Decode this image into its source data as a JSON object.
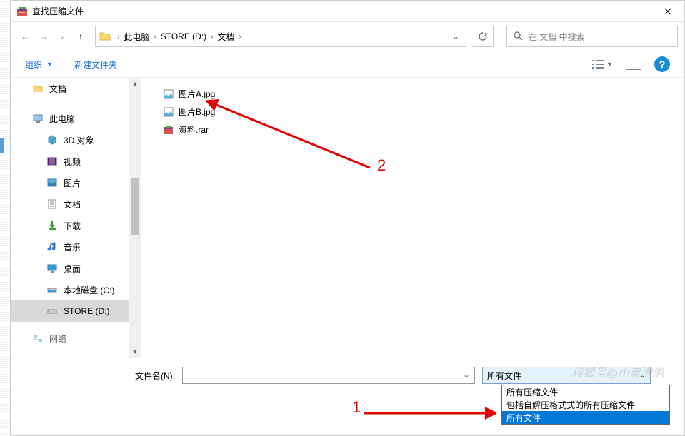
{
  "title": "查找压缩文件",
  "breadcrumbs": [
    "此电脑",
    "STORE (D:)",
    "文档"
  ],
  "search_placeholder": "在 文档 中搜索",
  "toolbar": {
    "organize": "组织",
    "new_folder": "新建文件夹"
  },
  "sidebar": {
    "quick": {
      "documents": "文档"
    },
    "this_pc": "此电脑",
    "children": {
      "objects3d": "3D 对象",
      "videos": "视频",
      "pictures": "图片",
      "documents": "文档",
      "downloads": "下载",
      "music": "音乐",
      "desktop": "桌面",
      "drive_c": "本地磁盘 (C:)",
      "drive_d": "STORE (D:)",
      "more": "网络"
    }
  },
  "files": {
    "a": "图片A.jpg",
    "b": "图片B.jpg",
    "c": "资料.rar"
  },
  "filename_label": "文件名(N):",
  "filetype_selected": "所有文件",
  "filetype_options": {
    "opt0": "所有压缩文件",
    "opt1": "包括自解压格式式的所有压缩文件",
    "opt2": "所有文件"
  },
  "annotations": {
    "one": "1",
    "two": "2"
  },
  "watermark": "搜狐号@小奥泡泡"
}
